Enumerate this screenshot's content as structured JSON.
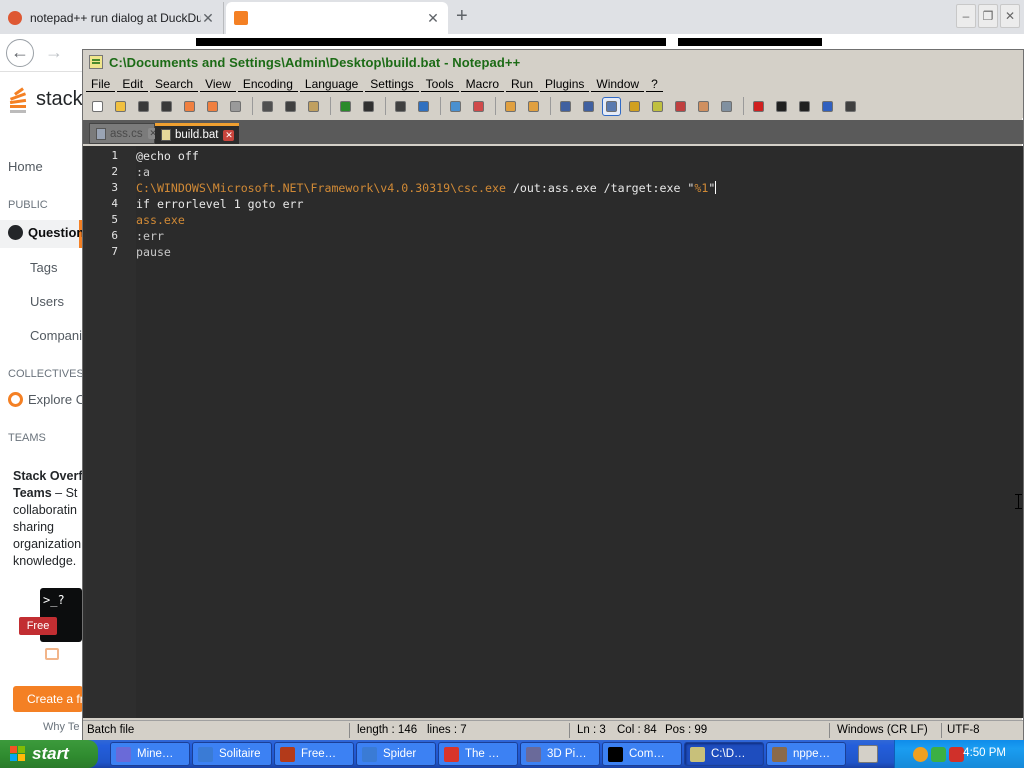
{
  "browser": {
    "tabs": [
      {
        "title": "notepad++ run dialog at DuckDuc",
        "favicon_color": "#de5833"
      },
      {
        "title": "",
        "favicon_color": "#f48024"
      }
    ],
    "new_tab": "+",
    "window_buttons": {
      "minimize": "–",
      "restore": "❐",
      "close": "✕"
    },
    "nav": {
      "back": "←",
      "forward": "→"
    }
  },
  "stackoverflow": {
    "logo_text": "stack",
    "nav_home": "Home",
    "public_heading": "PUBLIC",
    "nav_questions": "Question",
    "nav_tags": "Tags",
    "nav_users": "Users",
    "nav_companies": "Compani",
    "collectives_heading": "COLLECTIVES",
    "nav_explore": "Explore C",
    "teams_heading": "TEAMS",
    "teams_title": "Stack Overf",
    "teams_title2": "Teams",
    "teams_dash": " – St",
    "teams_body": [
      "collaboratin",
      "sharing",
      "organization",
      "knowledge."
    ],
    "terminal_glyph": ">_?",
    "free_badge": "Free",
    "create_button": "Create a fr",
    "why_text": "Why Te"
  },
  "notepadpp": {
    "title": "C:\\Documents and Settings\\Admin\\Desktop\\build.bat - Notepad++",
    "menu": [
      "File",
      "Edit",
      "Search",
      "View",
      "Encoding",
      "Language",
      "Settings",
      "Tools",
      "Macro",
      "Run",
      "Plugins",
      "Window",
      "?"
    ],
    "toolbar_icons": [
      "new-file-icon",
      "open-file-icon",
      "save-icon",
      "save-all-icon",
      "close-icon",
      "close-all-icon",
      "print-icon",
      "sep",
      "cut-icon",
      "copy-icon",
      "paste-icon",
      "sep",
      "undo-icon",
      "redo-icon",
      "sep",
      "find-icon",
      "replace-icon",
      "sep",
      "zoom-in-icon",
      "zoom-out-icon",
      "sep",
      "sync-vertical-icon",
      "sync-horizontal-icon",
      "sep",
      "word-wrap-icon",
      "show-all-chars-icon",
      "indent-guide-icon",
      "user-lang-icon",
      "doc-map-icon",
      "function-list-icon",
      "folder-workspace-icon",
      "monitoring-icon",
      "sep",
      "record-macro-icon",
      "stop-macro-icon",
      "play-macro-icon",
      "run-macro-multiple-icon",
      "save-macro-icon"
    ],
    "file_tabs": [
      {
        "label": "ass.cs",
        "active": false
      },
      {
        "label": "build.bat",
        "active": true
      }
    ],
    "tab_close_glyph": "✕",
    "lines": [
      {
        "num": "1",
        "tokens": [
          {
            "t": "@echo off",
            "c": "kw"
          }
        ]
      },
      {
        "num": "2",
        "tokens": [
          {
            "t": ":a",
            "c": "lbl"
          }
        ]
      },
      {
        "num": "3",
        "tokens": [
          {
            "t": "C:\\WINDOWS\\Microsoft.NET\\Framework\\v4.0.30319\\csc.exe",
            "c": "path"
          },
          {
            "t": " /out:ass.exe /target:exe \"",
            "c": "kw"
          },
          {
            "t": "%1",
            "c": "str"
          },
          {
            "t": "\"",
            "c": "kw"
          }
        ]
      },
      {
        "num": "4",
        "tokens": [
          {
            "t": "if errorlevel 1 goto err",
            "c": "kw"
          }
        ]
      },
      {
        "num": "5",
        "tokens": [
          {
            "t": "ass.exe",
            "c": "path"
          }
        ]
      },
      {
        "num": "6",
        "tokens": [
          {
            "t": ":err",
            "c": "lbl"
          }
        ]
      },
      {
        "num": "7",
        "tokens": [
          {
            "t": "pause",
            "c": "lbl"
          }
        ]
      }
    ],
    "status": {
      "file_type": "Batch file",
      "length": "length : 146",
      "lines": "lines : 7",
      "ln": "Ln : 3",
      "col": "Col : 84",
      "pos": "Pos : 99",
      "eol": "Windows (CR LF)",
      "encoding": "UTF-8"
    }
  },
  "taskbar": {
    "start_label": "start",
    "tasks": [
      {
        "label": "Mine…",
        "icon_color": "#6a6ad8"
      },
      {
        "label": "Solitaire",
        "icon_color": "#3a7bd5"
      },
      {
        "label": "Free…",
        "icon_color": "#b33a1a"
      },
      {
        "label": "Spider",
        "icon_color": "#3a7bd5"
      },
      {
        "label": "The …",
        "icon_color": "#d9352b"
      },
      {
        "label": "3D Pi…",
        "icon_color": "#6a6a9a"
      },
      {
        "label": "Com…",
        "icon_color": "#000000"
      },
      {
        "label": "C:\\D…",
        "icon_color": "#c8c07a"
      },
      {
        "label": "nppe…",
        "icon_color": "#8a6a4a"
      }
    ],
    "clock": "4:50 PM"
  },
  "colors": {
    "npp_title_green": "#1c6b16",
    "editor_bg": "#2b2b2b",
    "path_orange": "#d18a36",
    "so_orange": "#f48024",
    "xp_blue": "#245edb"
  }
}
